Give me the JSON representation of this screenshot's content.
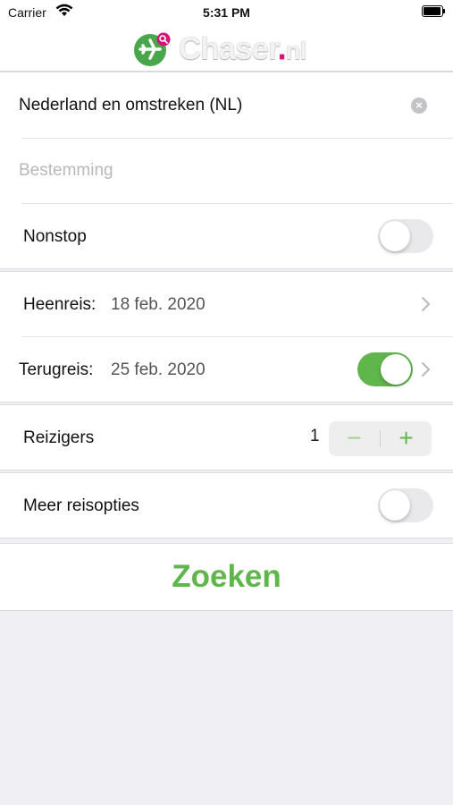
{
  "status_bar": {
    "carrier": "Carrier",
    "time": "5:31 PM",
    "wifi_icon": "wifi-icon",
    "battery_icon": "battery-icon"
  },
  "header": {
    "logo_text": "Chaser",
    "logo_dot": ".",
    "logo_tld": "nl",
    "logo_icon": "plane-search-logo-icon"
  },
  "form": {
    "origin": {
      "value": "Nederland en omstreken (NL)",
      "clear_icon": "clear-circle-icon",
      "clear_glyph": "×"
    },
    "destination": {
      "placeholder": "Bestemming"
    },
    "nonstop": {
      "label": "Nonstop",
      "enabled": false
    },
    "outbound": {
      "label": "Heenreis:",
      "date": "18 feb. 2020",
      "chevron_icon": "chevron-right-icon"
    },
    "return": {
      "label": "Terugreis:",
      "date": "25 feb. 2020",
      "enabled": true,
      "chevron_icon": "chevron-right-icon"
    },
    "travelers": {
      "label": "Reizigers",
      "count": "1",
      "minus": "−",
      "plus": "+"
    },
    "more_options": {
      "label": "Meer reisopties",
      "enabled": false
    }
  },
  "search_button": {
    "label": "Zoeken"
  },
  "colors": {
    "accent_green": "#5fb64a",
    "brand_pink": "#d6137a",
    "background": "#efeff4"
  }
}
